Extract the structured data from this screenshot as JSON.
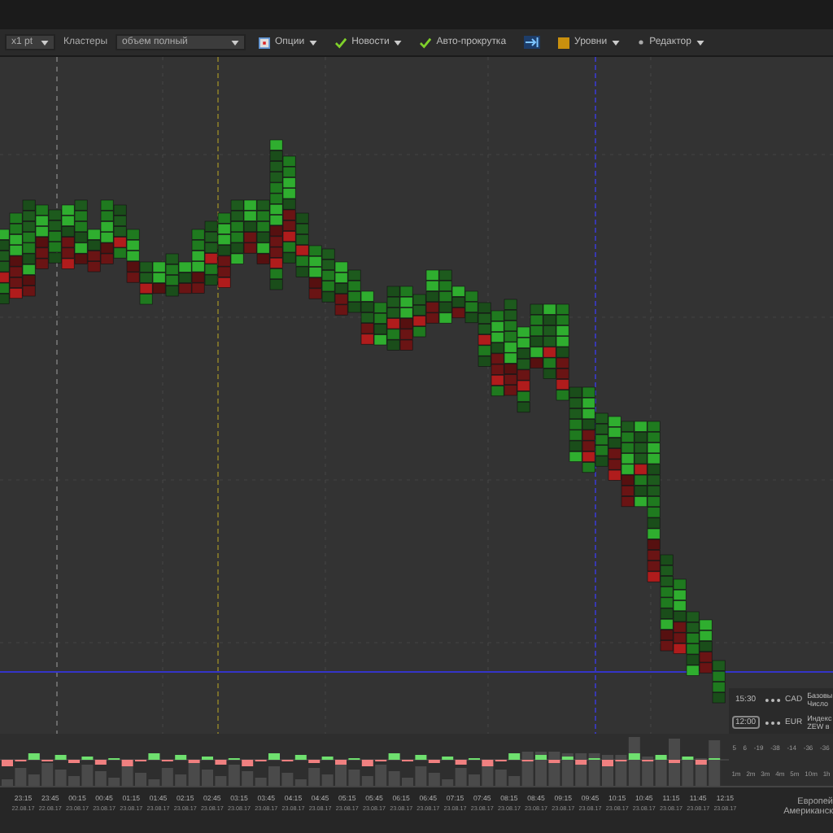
{
  "toolbar": {
    "scale": {
      "value": "x1 pt"
    },
    "clusters_label": "Кластеры",
    "cluster_mode": {
      "value": "объем полный"
    },
    "buttons": [
      {
        "kind": "options",
        "label": "Опции",
        "dropdown": true
      },
      {
        "kind": "check",
        "label": "Новости",
        "dropdown": true
      },
      {
        "kind": "check",
        "label": "Авто-прокрутка",
        "dropdown": false
      },
      {
        "kind": "arrow",
        "dropdown": false
      },
      {
        "kind": "levels",
        "label": "Уровни",
        "dropdown": true
      },
      {
        "kind": "editor",
        "label": "Редактор",
        "dropdown": true
      }
    ]
  },
  "news": [
    {
      "time": "15:30",
      "currency": "CAD",
      "lines": [
        "Базовы",
        "Число"
      ],
      "boxed": false
    },
    {
      "time": "12:00",
      "currency": "EUR",
      "lines": [
        "Индекс",
        "ZEW в"
      ],
      "boxed": true
    }
  ],
  "delta_stats": [
    "5",
    "6",
    "-19",
    "-38",
    "-14",
    "-36",
    "-36"
  ],
  "volume_periods": [
    "1m",
    "2m",
    "3m",
    "4m",
    "5m",
    "10m",
    "1h"
  ],
  "time_axis": [
    {
      "time": "23:15",
      "date": "22.08.17"
    },
    {
      "time": "23:45",
      "date": "22.08.17"
    },
    {
      "time": "00:15",
      "date": "23.08.17"
    },
    {
      "time": "00:45",
      "date": "23.08.17"
    },
    {
      "time": "01:15",
      "date": "23.08.17"
    },
    {
      "time": "01:45",
      "date": "23.08.17"
    },
    {
      "time": "02:15",
      "date": "23.08.17"
    },
    {
      "time": "02:45",
      "date": "23.08.17"
    },
    {
      "time": "03:15",
      "date": "23.08.17"
    },
    {
      "time": "03:45",
      "date": "23.08.17"
    },
    {
      "time": "04:15",
      "date": "23.08.17"
    },
    {
      "time": "04:45",
      "date": "23.08.17"
    },
    {
      "time": "05:15",
      "date": "23.08.17"
    },
    {
      "time": "05:45",
      "date": "23.08.17"
    },
    {
      "time": "06:15",
      "date": "23.08.17"
    },
    {
      "time": "06:45",
      "date": "23.08.17"
    },
    {
      "time": "07:15",
      "date": "23.08.17"
    },
    {
      "time": "07:45",
      "date": "23.08.17"
    },
    {
      "time": "08:15",
      "date": "23.08.17"
    },
    {
      "time": "08:45",
      "date": "23.08.17"
    },
    {
      "time": "09:15",
      "date": "23.08.17"
    },
    {
      "time": "09:45",
      "date": "23.08.17"
    },
    {
      "time": "10:15",
      "date": "23.08.17"
    },
    {
      "time": "10:45",
      "date": "23.08.17"
    },
    {
      "time": "11:15",
      "date": "23.08.17"
    },
    {
      "time": "11:45",
      "date": "23.08.17"
    },
    {
      "time": "12:15",
      "date": "23.08.17"
    }
  ],
  "sessions": [
    "Европей",
    "Американск"
  ]
}
